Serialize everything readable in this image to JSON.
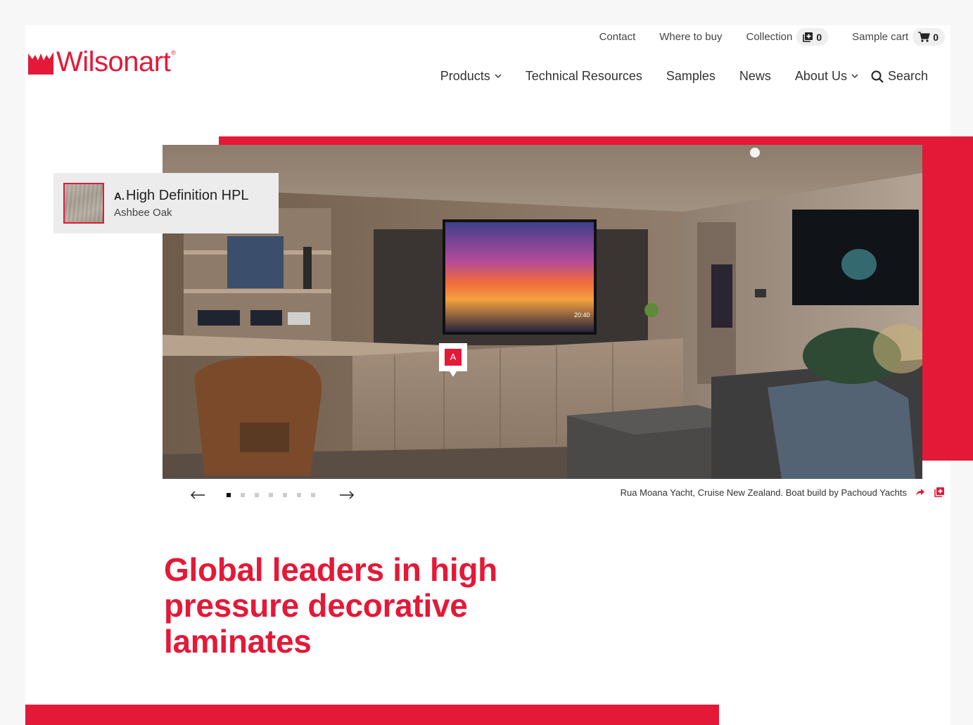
{
  "brand": {
    "name": "Wilsonart",
    "reg": "®",
    "color": "#e31937"
  },
  "utility_nav": {
    "contact": "Contact",
    "where_to_buy": "Where to buy",
    "collection": {
      "label": "Collection",
      "count": "0",
      "icon": "collection-plus-icon"
    },
    "sample_cart": {
      "label": "Sample cart",
      "count": "0",
      "icon": "cart-icon"
    }
  },
  "main_nav": {
    "products": "Products",
    "technical_resources": "Technical Resources",
    "samples": "Samples",
    "news": "News",
    "about_us": "About Us",
    "search": "Search"
  },
  "hero": {
    "product_tag": {
      "letter": "A.",
      "title": "High Definition HPL",
      "subtitle": "Ashbee Oak"
    },
    "hotspot_label": "A",
    "slides": {
      "total": 7,
      "active": 1
    },
    "caption": "Rua Moana Yacht, Cruise New Zealand. Boat build by Pachoud Yachts",
    "tv_time": "20:40"
  },
  "headline": "Global leaders in high pressure decorative laminates"
}
